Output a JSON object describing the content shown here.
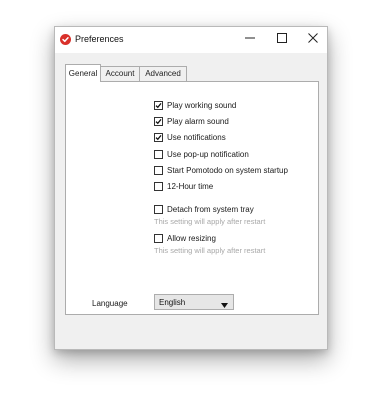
{
  "window": {
    "title": "Preferences"
  },
  "icons": {
    "app": "pomodoro-check-icon",
    "minimize": "minimize-icon",
    "maximize": "maximize-icon",
    "close": "close-icon",
    "dropdown": "chevron-down-icon"
  },
  "colors": {
    "app_icon": "#d9302a",
    "hint_text": "#a8a8a8"
  },
  "tabs": [
    {
      "label": "General",
      "active": true
    },
    {
      "label": "Account",
      "active": false
    },
    {
      "label": "Advanced",
      "active": false
    }
  ],
  "general": {
    "options": [
      {
        "label": "Play working sound",
        "checked": true
      },
      {
        "label": "Play alarm sound",
        "checked": true
      },
      {
        "label": "Use notifications",
        "checked": true
      },
      {
        "label": "Use pop-up notification",
        "checked": false
      },
      {
        "label": "Start Pomotodo on system startup",
        "checked": false
      },
      {
        "label": "12-Hour time",
        "checked": false
      },
      {
        "label": "Detach from system tray",
        "checked": false
      },
      {
        "label": "Allow resizing",
        "checked": false
      }
    ],
    "restart_hint": "This setting will apply after restart",
    "language": {
      "label": "Language",
      "value": "English"
    }
  }
}
